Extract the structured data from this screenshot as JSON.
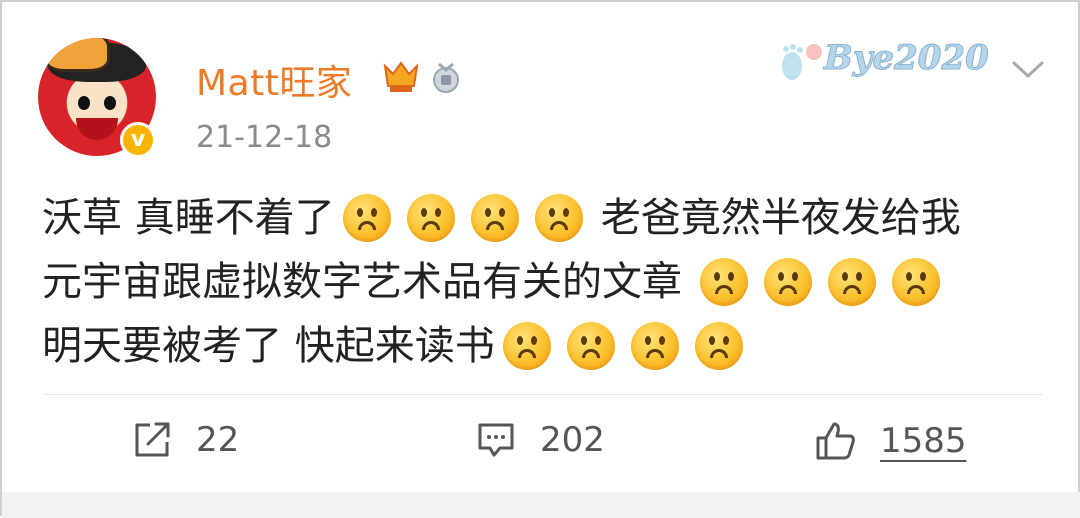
{
  "post": {
    "username": "Matt旺家",
    "timestamp": "21-12-18",
    "sticker_text": "Bye2020",
    "content_lines": [
      {
        "segments": [
          "沃草 真睡不着了",
          "老爸竟然半夜发给我"
        ]
      },
      {
        "segments": [
          "元宇宙跟虚拟数字艺术品有关的文章"
        ]
      },
      {
        "segments": [
          "明天要被考了 快起来读书"
        ]
      }
    ],
    "emoji_name": "upside-down-face-emoji"
  },
  "actions": {
    "repost_count": "22",
    "comment_count": "202",
    "like_count": "1585"
  },
  "colors": {
    "username": "#ee7a26",
    "timestamp": "#8a8a8a",
    "text": "#222222",
    "action": "#555555"
  }
}
